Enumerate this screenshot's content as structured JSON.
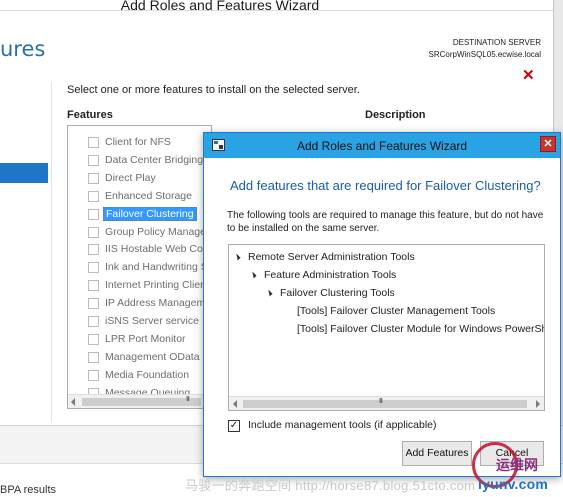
{
  "background_wizard": {
    "window_title": "Add Roles and Features Wizard",
    "heading": "ures",
    "destination_label": "DESTINATION SERVER",
    "destination_server": "SRCorpWinSQL05.ecwise.local",
    "instruction": "Select one or more features to install on the selected server.",
    "features_header": "Features",
    "description_header": "Description",
    "features": [
      {
        "label": "Client for NFS",
        "checked": false,
        "selected": false
      },
      {
        "label": "Data Center Bridging",
        "checked": false,
        "selected": false
      },
      {
        "label": "Direct Play",
        "checked": false,
        "selected": false
      },
      {
        "label": "Enhanced Storage",
        "checked": false,
        "selected": false
      },
      {
        "label": "Failover Clustering",
        "checked": false,
        "selected": true
      },
      {
        "label": "Group Policy Managem",
        "checked": false,
        "selected": false
      },
      {
        "label": "IIS Hostable Web Core",
        "checked": false,
        "selected": false
      },
      {
        "label": "Ink and Handwriting S",
        "checked": false,
        "selected": false
      },
      {
        "label": "Internet Printing Clien",
        "checked": false,
        "selected": false
      },
      {
        "label": "IP Address Manageme",
        "checked": false,
        "selected": false
      },
      {
        "label": "iSNS Server service",
        "checked": false,
        "selected": false
      },
      {
        "label": "LPR Port Monitor",
        "checked": false,
        "selected": false
      },
      {
        "label": "Management OData II",
        "checked": false,
        "selected": false
      },
      {
        "label": "Media Foundation",
        "checked": false,
        "selected": false
      },
      {
        "label": "Message Queuing",
        "checked": false,
        "selected": false
      }
    ],
    "scroll_grip": "III",
    "bottom_tab": "BPA results"
  },
  "dialog": {
    "title": "Add Roles and Features Wizard",
    "close_symbol": "✕",
    "heading": "Add features that are required for Failover Clustering?",
    "description": "The following tools are required to manage this feature, but do not have to be installed on the same server.",
    "tree": [
      {
        "label": "Remote Server Administration Tools",
        "level": 0,
        "expanded": true
      },
      {
        "label": "Feature Administration Tools",
        "level": 1,
        "expanded": true
      },
      {
        "label": "Failover Clustering Tools",
        "level": 2,
        "expanded": true
      },
      {
        "label": "[Tools] Failover Cluster Management Tools",
        "level": 3,
        "expanded": false
      },
      {
        "label": "[Tools] Failover Cluster Module for Windows PowerShell",
        "level": 3,
        "expanded": false
      }
    ],
    "scroll_grip": "III",
    "include_tools_label": "Include management tools (if applicable)",
    "include_tools_checked": true,
    "checkmark": "✓",
    "add_button": "Add Features",
    "cancel_button": "Cancel"
  },
  "watermark": {
    "text": "马骏一的奔跑空间 http://horse87.blog.51cto.com",
    "brand": "运维网",
    "url": "iyunv.com"
  },
  "colors": {
    "accent": "#2aa3e5",
    "heading_blue": "#1a5ea8",
    "selection": "#3399ff",
    "close_red": "#d20000"
  }
}
